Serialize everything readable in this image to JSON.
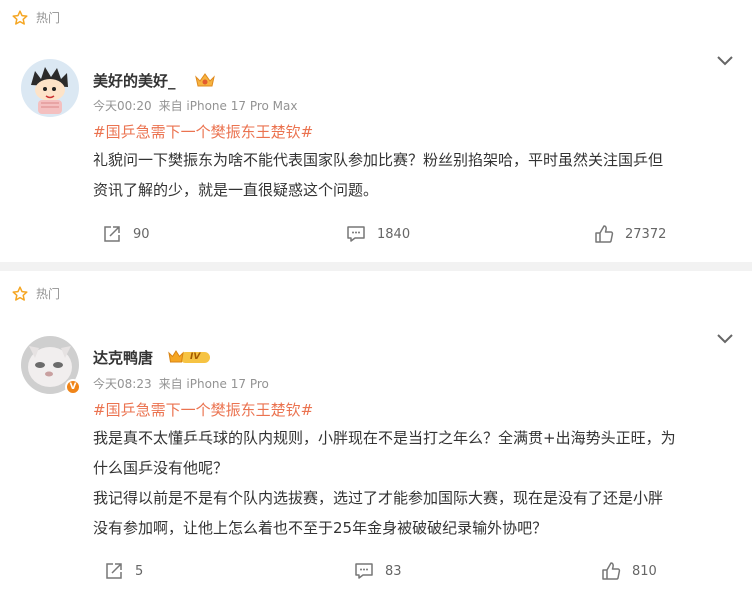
{
  "posts": [
    {
      "hot_label": "热门",
      "username": "美好的美好_",
      "time": "今天00:20",
      "source": "来自 iPhone 17 Pro Max",
      "topic": "#国乒急需下一个樊振东王楚钦#",
      "text_lines": [
        "礼貌问一下樊振东为啥不能代表国家队参加比赛？粉丝别掐架哈，平时虽然关注国乒但",
        "资讯了解的少，就是一直很疑惑这个问题。"
      ],
      "reposts": "90",
      "comments": "1840",
      "likes": "27372"
    },
    {
      "hot_label": "热门",
      "username": "达克鸭唐",
      "level_badge": "IV",
      "verified_mark": "V",
      "time": "今天08:23",
      "source": "来自 iPhone 17 Pro",
      "topic": "#国乒急需下一个樊振东王楚钦#",
      "text_lines": [
        "我是真不太懂乒乓球的队内规则，小胖现在不是当打之年么？全满贯+出海势头正旺，为",
        "什么国乒没有他呢？",
        "我记得以前是不是有个队内选拔赛，选过了才能参加国际大赛，现在是没有了还是小胖",
        "没有参加啊，让他上怎么着也不至于25年金身被破破纪录输外协吧？"
      ],
      "reposts": "5",
      "comments": "83",
      "likes": "810"
    }
  ],
  "colors": {
    "topic": "#eb7350",
    "hot_icon": "#f5a623",
    "meta": "#939393",
    "text": "#333333",
    "badge": "#f08519",
    "page_bg": "#f2f2f2"
  }
}
